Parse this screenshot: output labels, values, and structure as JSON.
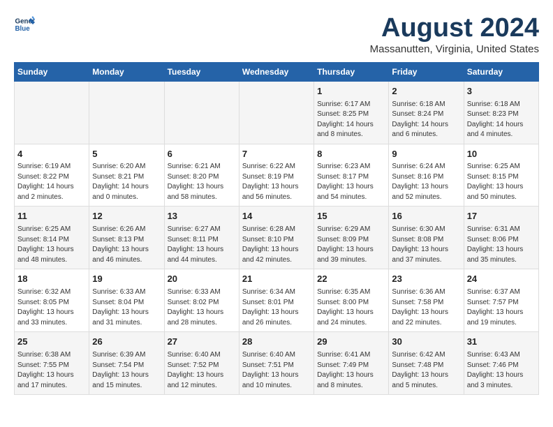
{
  "header": {
    "logo_line1": "General",
    "logo_line2": "Blue",
    "main_title": "August 2024",
    "subtitle": "Massanutten, Virginia, United States"
  },
  "columns": [
    "Sunday",
    "Monday",
    "Tuesday",
    "Wednesday",
    "Thursday",
    "Friday",
    "Saturday"
  ],
  "weeks": [
    [
      {
        "day": "",
        "text": ""
      },
      {
        "day": "",
        "text": ""
      },
      {
        "day": "",
        "text": ""
      },
      {
        "day": "",
        "text": ""
      },
      {
        "day": "1",
        "text": "Sunrise: 6:17 AM\nSunset: 8:25 PM\nDaylight: 14 hours and 8 minutes."
      },
      {
        "day": "2",
        "text": "Sunrise: 6:18 AM\nSunset: 8:24 PM\nDaylight: 14 hours and 6 minutes."
      },
      {
        "day": "3",
        "text": "Sunrise: 6:18 AM\nSunset: 8:23 PM\nDaylight: 14 hours and 4 minutes."
      }
    ],
    [
      {
        "day": "4",
        "text": "Sunrise: 6:19 AM\nSunset: 8:22 PM\nDaylight: 14 hours and 2 minutes."
      },
      {
        "day": "5",
        "text": "Sunrise: 6:20 AM\nSunset: 8:21 PM\nDaylight: 14 hours and 0 minutes."
      },
      {
        "day": "6",
        "text": "Sunrise: 6:21 AM\nSunset: 8:20 PM\nDaylight: 13 hours and 58 minutes."
      },
      {
        "day": "7",
        "text": "Sunrise: 6:22 AM\nSunset: 8:19 PM\nDaylight: 13 hours and 56 minutes."
      },
      {
        "day": "8",
        "text": "Sunrise: 6:23 AM\nSunset: 8:17 PM\nDaylight: 13 hours and 54 minutes."
      },
      {
        "day": "9",
        "text": "Sunrise: 6:24 AM\nSunset: 8:16 PM\nDaylight: 13 hours and 52 minutes."
      },
      {
        "day": "10",
        "text": "Sunrise: 6:25 AM\nSunset: 8:15 PM\nDaylight: 13 hours and 50 minutes."
      }
    ],
    [
      {
        "day": "11",
        "text": "Sunrise: 6:25 AM\nSunset: 8:14 PM\nDaylight: 13 hours and 48 minutes."
      },
      {
        "day": "12",
        "text": "Sunrise: 6:26 AM\nSunset: 8:13 PM\nDaylight: 13 hours and 46 minutes."
      },
      {
        "day": "13",
        "text": "Sunrise: 6:27 AM\nSunset: 8:11 PM\nDaylight: 13 hours and 44 minutes."
      },
      {
        "day": "14",
        "text": "Sunrise: 6:28 AM\nSunset: 8:10 PM\nDaylight: 13 hours and 42 minutes."
      },
      {
        "day": "15",
        "text": "Sunrise: 6:29 AM\nSunset: 8:09 PM\nDaylight: 13 hours and 39 minutes."
      },
      {
        "day": "16",
        "text": "Sunrise: 6:30 AM\nSunset: 8:08 PM\nDaylight: 13 hours and 37 minutes."
      },
      {
        "day": "17",
        "text": "Sunrise: 6:31 AM\nSunset: 8:06 PM\nDaylight: 13 hours and 35 minutes."
      }
    ],
    [
      {
        "day": "18",
        "text": "Sunrise: 6:32 AM\nSunset: 8:05 PM\nDaylight: 13 hours and 33 minutes."
      },
      {
        "day": "19",
        "text": "Sunrise: 6:33 AM\nSunset: 8:04 PM\nDaylight: 13 hours and 31 minutes."
      },
      {
        "day": "20",
        "text": "Sunrise: 6:33 AM\nSunset: 8:02 PM\nDaylight: 13 hours and 28 minutes."
      },
      {
        "day": "21",
        "text": "Sunrise: 6:34 AM\nSunset: 8:01 PM\nDaylight: 13 hours and 26 minutes."
      },
      {
        "day": "22",
        "text": "Sunrise: 6:35 AM\nSunset: 8:00 PM\nDaylight: 13 hours and 24 minutes."
      },
      {
        "day": "23",
        "text": "Sunrise: 6:36 AM\nSunset: 7:58 PM\nDaylight: 13 hours and 22 minutes."
      },
      {
        "day": "24",
        "text": "Sunrise: 6:37 AM\nSunset: 7:57 PM\nDaylight: 13 hours and 19 minutes."
      }
    ],
    [
      {
        "day": "25",
        "text": "Sunrise: 6:38 AM\nSunset: 7:55 PM\nDaylight: 13 hours and 17 minutes."
      },
      {
        "day": "26",
        "text": "Sunrise: 6:39 AM\nSunset: 7:54 PM\nDaylight: 13 hours and 15 minutes."
      },
      {
        "day": "27",
        "text": "Sunrise: 6:40 AM\nSunset: 7:52 PM\nDaylight: 13 hours and 12 minutes."
      },
      {
        "day": "28",
        "text": "Sunrise: 6:40 AM\nSunset: 7:51 PM\nDaylight: 13 hours and 10 minutes."
      },
      {
        "day": "29",
        "text": "Sunrise: 6:41 AM\nSunset: 7:49 PM\nDaylight: 13 hours and 8 minutes."
      },
      {
        "day": "30",
        "text": "Sunrise: 6:42 AM\nSunset: 7:48 PM\nDaylight: 13 hours and 5 minutes."
      },
      {
        "day": "31",
        "text": "Sunrise: 6:43 AM\nSunset: 7:46 PM\nDaylight: 13 hours and 3 minutes."
      }
    ]
  ]
}
